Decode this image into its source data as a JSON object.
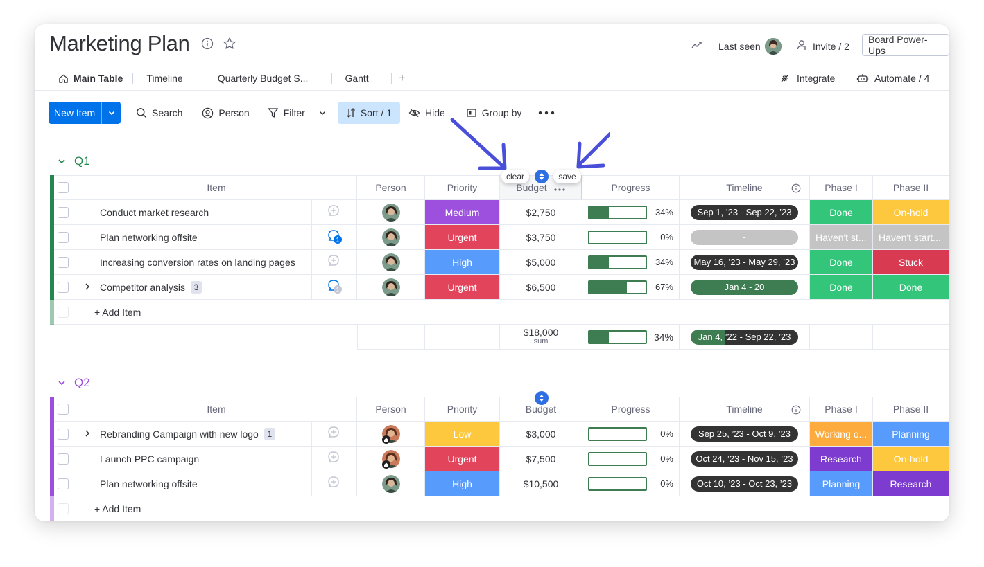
{
  "board": {
    "title": "Marketing Plan",
    "last_seen_label": "Last seen",
    "invite_label": "Invite / 2",
    "powerups_label": "Board Power-Ups",
    "integrate_label": "Integrate",
    "automate_label": "Automate / 4"
  },
  "tabs": [
    {
      "label": "Main Table",
      "active": true
    },
    {
      "label": "Timeline"
    },
    {
      "label": "Quarterly Budget S..."
    },
    {
      "label": "Gantt"
    },
    {
      "label": "+"
    }
  ],
  "toolbar": {
    "new_item": "New Item",
    "search": "Search",
    "person": "Person",
    "filter": "Filter",
    "sort": "Sort / 1",
    "hide": "Hide",
    "group_by": "Group by"
  },
  "sort_popup": {
    "clear": "clear",
    "save": "save"
  },
  "columns": {
    "item": "Item",
    "person": "Person",
    "priority": "Priority",
    "budget": "Budget",
    "progress": "Progress",
    "timeline": "Timeline",
    "phase1": "Phase I",
    "phase2": "Phase II"
  },
  "colors": {
    "q1": "#258750",
    "q2": "#9d50dd",
    "medium": "#9d50dd",
    "urgent": "#e2445c",
    "high": "#579bfc",
    "low": "#fdc73e",
    "done": "#33c57a",
    "onhold": "#fdc73e",
    "stuck": "#d83a52",
    "havent": "#c4c4c4",
    "working": "#fdab3d",
    "planning": "#579bfc",
    "research": "#7e3bd0"
  },
  "groups": [
    {
      "name": "Q1",
      "rows": [
        {
          "item": "Conduct market research",
          "priority": "Medium",
          "budget": "$2,750",
          "progress": 34,
          "progress_label": "34%",
          "timeline": "Sep 1, ’23 - Sep 22, ’23",
          "phase1": "Done",
          "phase2": "On-hold"
        },
        {
          "item": "Plan networking offsite",
          "priority": "Urgent",
          "budget": "$3,750",
          "progress": 0,
          "progress_label": "0%",
          "timeline": "-",
          "phase1": "Haven't st...",
          "phase2": "Haven't start...",
          "updates": "1"
        },
        {
          "item": "Increasing conversion rates on landing pages",
          "priority": "High",
          "budget": "$5,000",
          "progress": 34,
          "progress_label": "34%",
          "timeline": "May 16, ’23 - May 29, ’23",
          "phase1": "Done",
          "phase2": "Stuck"
        },
        {
          "item": "Competitor analysis",
          "subitems": "3",
          "priority": "Urgent",
          "budget": "$6,500",
          "progress": 67,
          "progress_label": "67%",
          "timeline": "Jan 4 - 20",
          "phase1": "Done",
          "phase2": "Done",
          "updates": "1"
        }
      ],
      "add_item": "+ Add Item",
      "summary": {
        "budget": "$18,000",
        "budget_caption": "sum",
        "progress": 34,
        "progress_label": "34%",
        "timeline": "Jan 4, ’22 - Sep 22, ’23"
      }
    },
    {
      "name": "Q2",
      "rows": [
        {
          "item": "Rebranding Campaign with new logo",
          "subitems": "1",
          "priority": "Low",
          "budget": "$3,000",
          "progress": 0,
          "progress_label": "0%",
          "timeline": "Sep 25, ’23 - Oct 9, ’23",
          "phase1": "Working o...",
          "phase2": "Planning"
        },
        {
          "item": "Launch PPC campaign",
          "priority": "Urgent",
          "budget": "$7,500",
          "progress": 0,
          "progress_label": "0%",
          "timeline": "Oct 24, ’23 - Nov 15, ’23",
          "phase1": "Research",
          "phase2": "On-hold"
        },
        {
          "item": "Plan networking offsite",
          "priority": "High",
          "budget": "$10,500",
          "progress": 0,
          "progress_label": "0%",
          "timeline": "Oct 10, ’23 - Oct 23, ’23",
          "phase1": "Planning",
          "phase2": "Research"
        }
      ],
      "add_item": "+ Add Item"
    }
  ]
}
